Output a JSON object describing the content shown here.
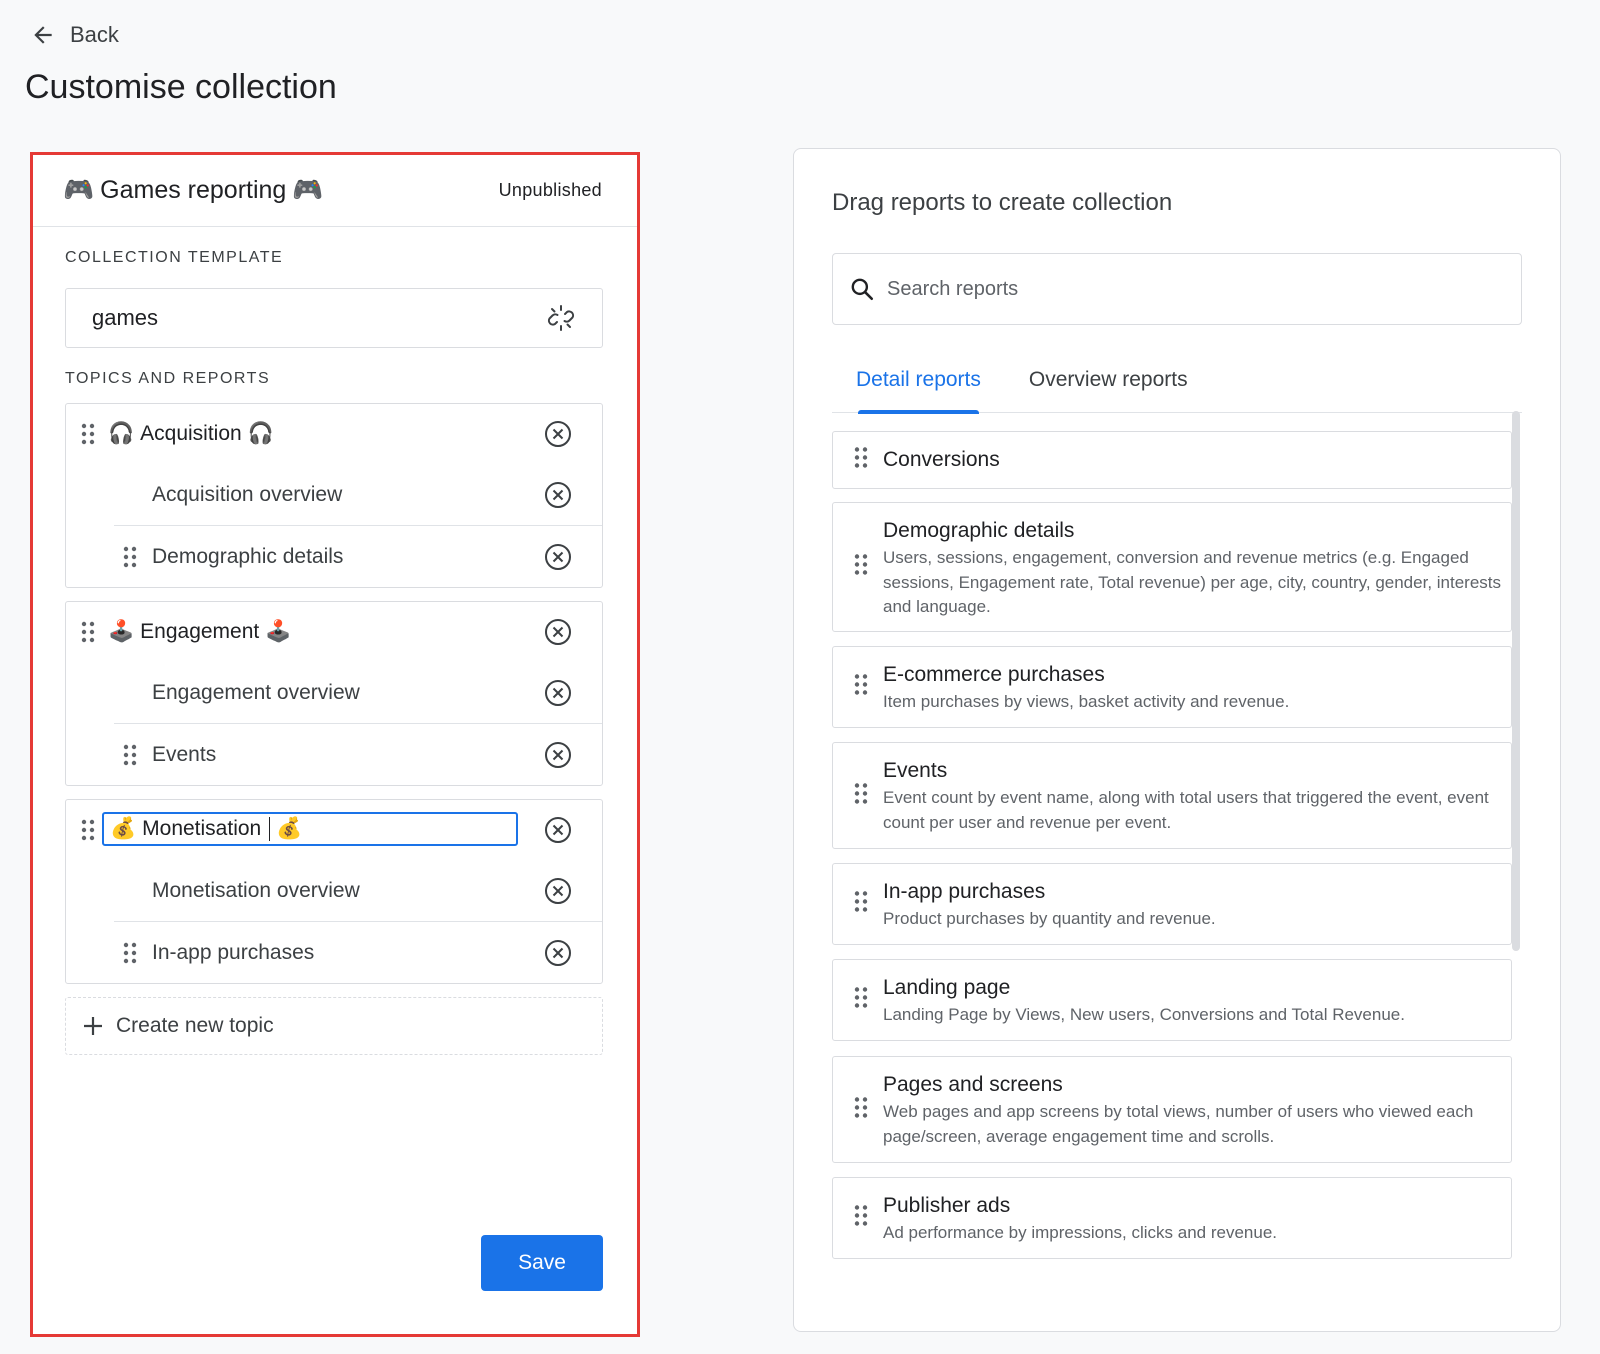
{
  "header": {
    "back_label": "Back",
    "page_title": "Customise collection"
  },
  "collection": {
    "name": "Games reporting",
    "name_emoji": "🎮",
    "status": "Unpublished",
    "template_section_label": "COLLECTION TEMPLATE",
    "template_value": "games",
    "topics_section_label": "TOPICS AND REPORTS",
    "topics": [
      {
        "name": "Acquisition",
        "emoji": "🎧",
        "reports": [
          "Acquisition overview",
          "Demographic details"
        ]
      },
      {
        "name": "Engagement",
        "emoji": "🕹️",
        "reports": [
          "Engagement overview",
          "Events"
        ]
      },
      {
        "name": "Monetisation",
        "emoji": "💰",
        "editing": true,
        "reports": [
          "Monetisation overview",
          "In-app purchases"
        ]
      }
    ],
    "create_topic_label": "Create new topic",
    "save_label": "Save"
  },
  "library": {
    "title": "Drag reports to create collection",
    "search_placeholder": "Search reports",
    "tabs": [
      {
        "label": "Detail reports",
        "active": true
      },
      {
        "label": "Overview reports",
        "active": false
      }
    ],
    "reports": [
      {
        "title": "Conversions",
        "description": ""
      },
      {
        "title": "Demographic details",
        "description": "Users, sessions, engagement, conversion and revenue metrics (e.g. Engaged sessions, Engagement rate, Total revenue) per age, city, country, gender, interests and language."
      },
      {
        "title": "E-commerce purchases",
        "description": "Item purchases by views, basket activity and revenue."
      },
      {
        "title": "Events",
        "description": "Event count by event name, along with total users that triggered the event, event count per user and revenue per event."
      },
      {
        "title": "In-app purchases",
        "description": "Product purchases by quantity and revenue."
      },
      {
        "title": "Landing page",
        "description": "Landing Page by Views, New users, Conversions and Total Revenue."
      },
      {
        "title": "Pages and screens",
        "description": "Web pages and app screens by total views, number of users who viewed each page/screen, average engagement time and scrolls."
      },
      {
        "title": "Publisher ads",
        "description": "Ad performance by impressions, clicks and revenue."
      }
    ]
  },
  "colors": {
    "accent": "#1a73e8",
    "highlight_border": "#e53935"
  }
}
